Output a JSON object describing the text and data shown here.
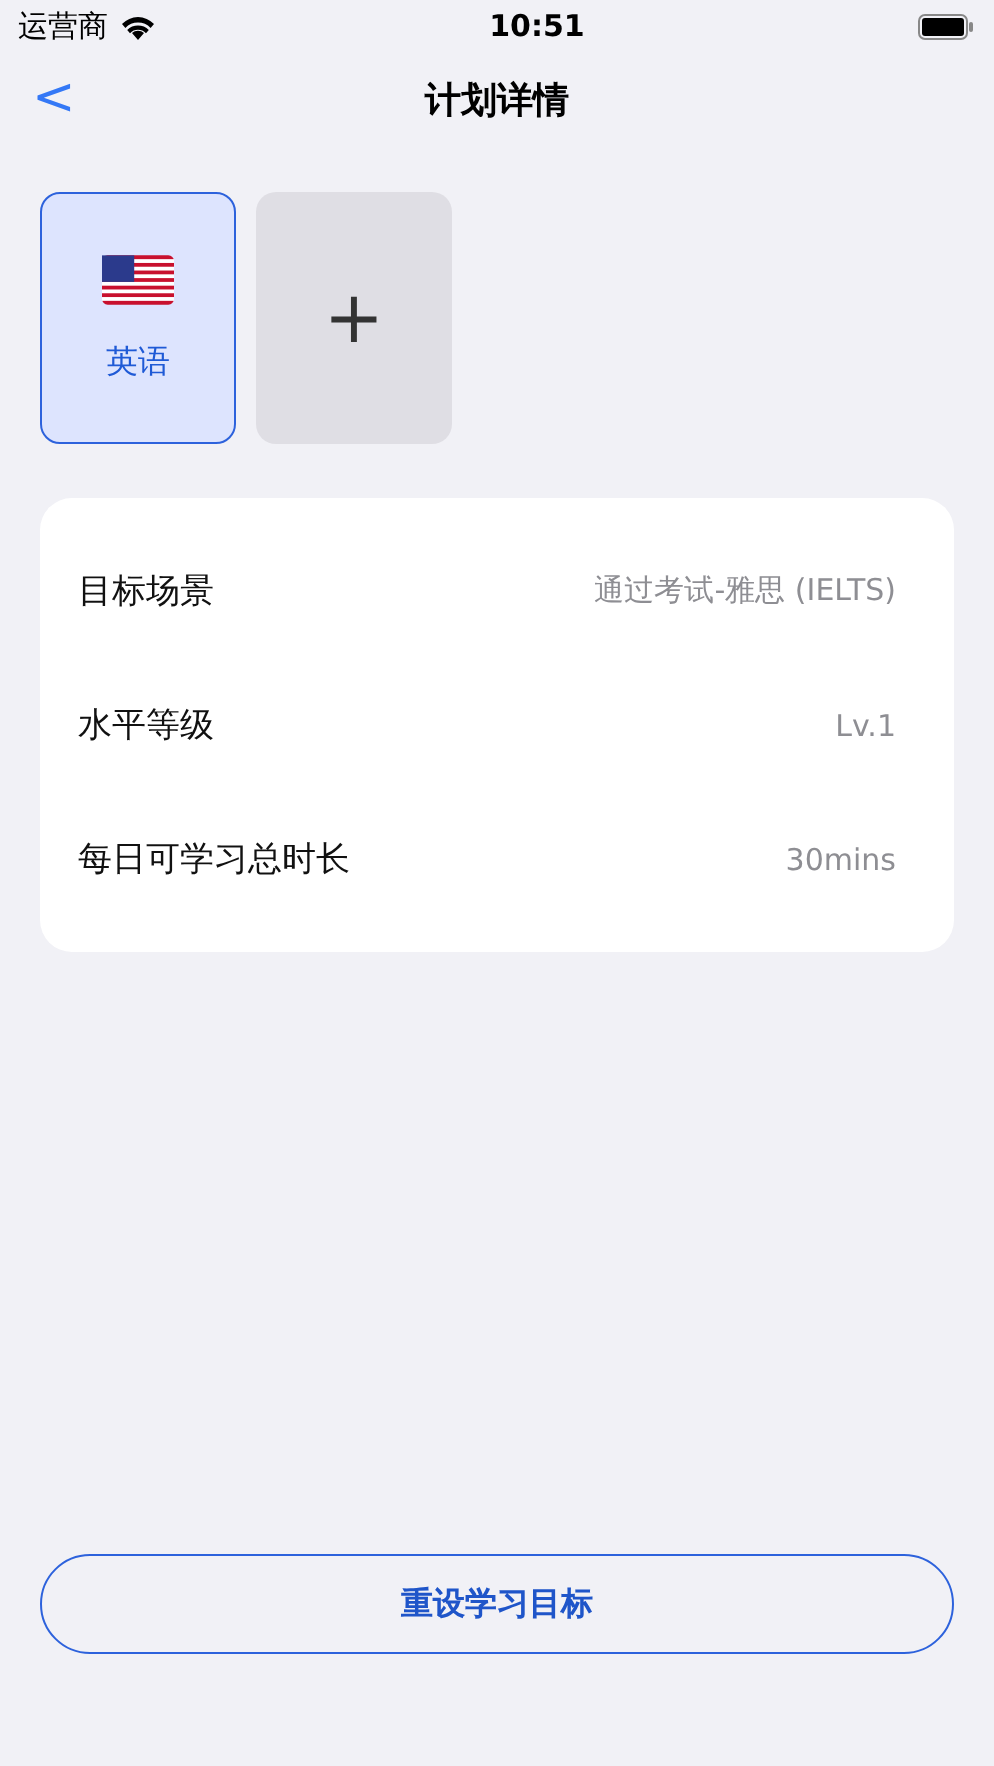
{
  "status_bar": {
    "carrier": "运营商",
    "time": "10:51"
  },
  "nav": {
    "back": "<",
    "title": "计划详情"
  },
  "languages": [
    {
      "label": "英语",
      "selected": true
    }
  ],
  "add_card": {
    "symbol": "+"
  },
  "details": [
    {
      "label": "目标场景",
      "value": "通过考试-雅思 (IELTS)"
    },
    {
      "label": "水平等级",
      "value": "Lv.1"
    },
    {
      "label": "每日可学习总时长",
      "value": "30mins"
    }
  ],
  "reset_button": {
    "label": "重设学习目标"
  }
}
